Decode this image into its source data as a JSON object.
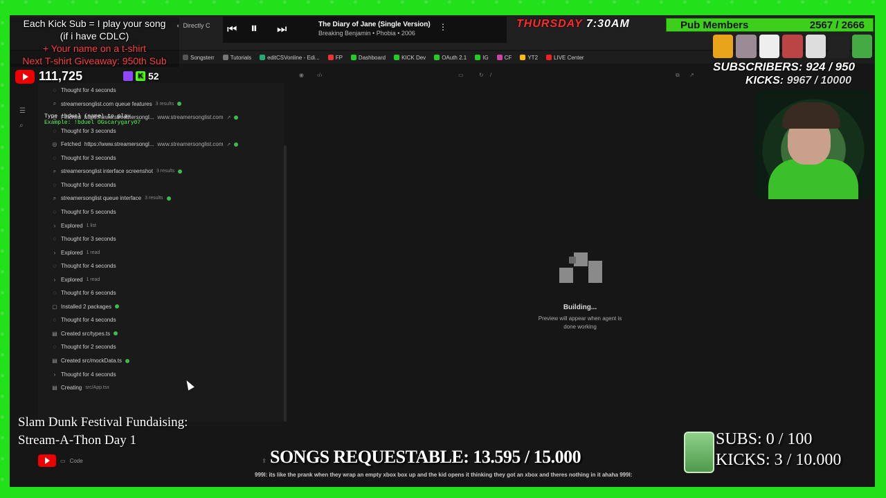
{
  "colors": {
    "frame": "#22e01a",
    "success_dot": "#3dbb4d",
    "accent_red": "#ff2a2a"
  },
  "browser": {
    "tab_title": "Directly C",
    "bookmarks": [
      "Songsterr",
      "Tutorials",
      "editCSVonline - Edi...",
      "FP",
      "Dashboard",
      "KICK Dev",
      "OAuth 2.1",
      "IG",
      "CF",
      "YT2",
      "LIVE Center"
    ]
  },
  "player": {
    "title": "The Diary of Jane (Single Version)",
    "subtitle": "Breaking Benjamin • Phobia • 2006"
  },
  "overlay": {
    "promo_line1": "Each Kick Sub = I play your song",
    "promo_line2": "(if i have CDLC)",
    "promo_line3": "+ Your name on a t-shirt",
    "promo_line4": "Next T-shirt Giveaway: 950th Sub",
    "youtube_count": "111,725",
    "kick_count": "52",
    "day": "THURSDAY",
    "time": "7:30AM",
    "pub_members_label": "Pub Members",
    "pub_members_value": "2567 / 2666",
    "subscribers_line": "SUBSCRIBERS: 924 / 950",
    "kicks_label": "KICKS: ",
    "kicks_value": "9967 / 10000",
    "type_cmd": "Type !bduel (name) to play",
    "type_example": "Example: !bduel OGscarygary07",
    "fundraising_line1": "Slam Dunk Festival Fundaising:",
    "fundraising_line2": "Stream-A-Thon Day 1",
    "songs_requestable": "SONGS REQUESTABLE: 13.595 / 15.000",
    "subs_goal": "SUBS:  0 / 100",
    "kicks_goal": "KICKS: 3 / 10.000",
    "ticker": "999l: its like the prank when they wrap an empty xbox box up and the kid opens it thinking they got an xbox and theres nothing in it ahaha  999l:"
  },
  "agent_log": [
    {
      "icon": "thought",
      "text": "Thought for 4 seconds"
    },
    {
      "icon": "search",
      "text": "streamersonglist.com queue features",
      "meta": "3 results",
      "done": true
    },
    {
      "icon": "fetch",
      "text": "Fetched",
      "url": "https://www.streamersongl...",
      "domain": "www.streamersonglist.com",
      "done": true
    },
    {
      "icon": "thought",
      "text": "Thought for 3 seconds"
    },
    {
      "icon": "fetch",
      "text": "Fetched",
      "url": "https://www.streamersongl...",
      "domain": "www.streamersonglist.com",
      "done": true
    },
    {
      "icon": "thought",
      "text": "Thought for 3 seconds"
    },
    {
      "icon": "search",
      "text": "streamersonglist interface screenshot",
      "meta": "3 results",
      "done": true
    },
    {
      "icon": "thought",
      "text": "Thought for 6 seconds"
    },
    {
      "icon": "search",
      "text": "streamersonglist queue interface",
      "meta": "3 results",
      "done": true
    },
    {
      "icon": "thought",
      "text": "Thought for 5 seconds"
    },
    {
      "icon": "chevron",
      "text": "Explored",
      "meta": "1 list"
    },
    {
      "icon": "thought",
      "text": "Thought for 3 seconds"
    },
    {
      "icon": "chevron",
      "text": "Explored",
      "meta": "1 read"
    },
    {
      "icon": "thought",
      "text": "Thought for 4 seconds"
    },
    {
      "icon": "chevron",
      "text": "Explored",
      "meta": "1 read"
    },
    {
      "icon": "thought",
      "text": "Thought for 6 seconds"
    },
    {
      "icon": "pkg",
      "text": "Installed 2 packages",
      "done": true
    },
    {
      "icon": "thought",
      "text": "Thought for 4 seconds"
    },
    {
      "icon": "file",
      "text": "Created src/types.ts",
      "done": true
    },
    {
      "icon": "thought",
      "text": "Thought for 2 seconds"
    },
    {
      "icon": "file",
      "text": "Created src/mockData.ts",
      "done": true
    },
    {
      "icon": "chevron",
      "text": "Thought for 4 seconds"
    },
    {
      "icon": "file",
      "text": "Creating",
      "meta": "src/App.tsx"
    }
  ],
  "preview": {
    "path": "/",
    "building_title": "Building...",
    "building_sub1": "Preview will appear when agent is",
    "building_sub2": "done working"
  },
  "input": {
    "label": "Code"
  }
}
